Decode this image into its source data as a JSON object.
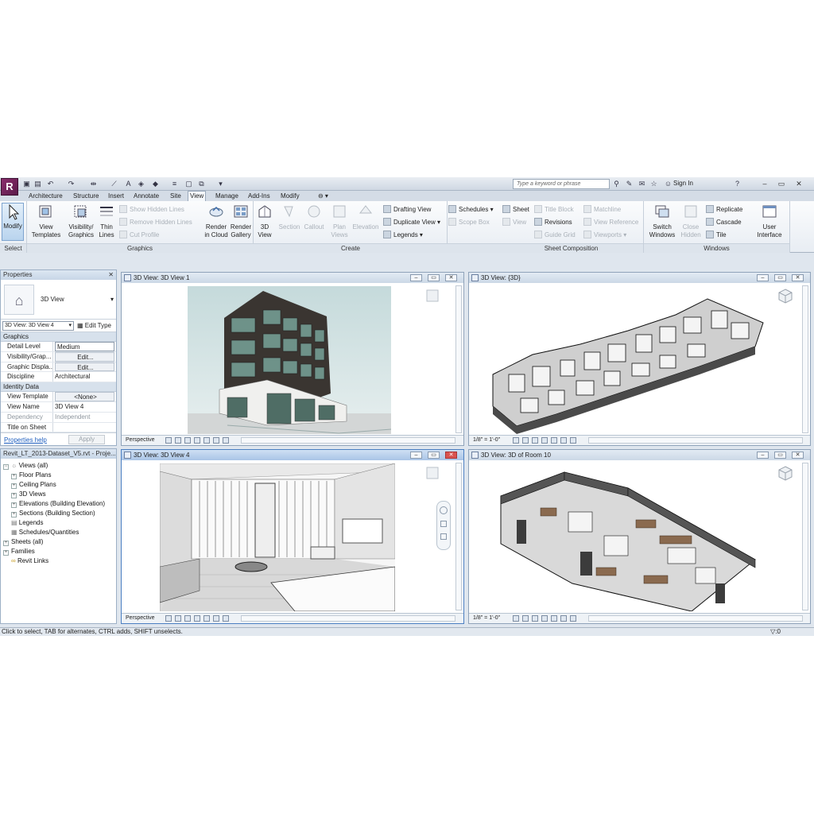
{
  "app": {
    "logo_letter": "R",
    "search_placeholder": "Type a keyword or phrase",
    "sign_in": "Sign In",
    "window_controls": [
      "–",
      "▭",
      "✕"
    ]
  },
  "tabs": [
    "Architecture",
    "Structure",
    "Insert",
    "Annotate",
    "Site",
    "View",
    "Manage",
    "Add-Ins",
    "Modify"
  ],
  "active_tab": "View",
  "ribbon": {
    "select": {
      "modify": "Modify",
      "title": "Select"
    },
    "graphics": {
      "title": "Graphics",
      "view_templates": [
        "View",
        "Templates"
      ],
      "visibility_graphics": [
        "Visibility/",
        "Graphics"
      ],
      "thin_lines": [
        "Thin",
        "Lines"
      ],
      "show_hidden_lines": "Show  Hidden Lines",
      "remove_hidden_lines": "Remove  Hidden Lines",
      "cut_profile": "Cut  Profile"
    },
    "create": {
      "title": "Create",
      "render_in_cloud": [
        "Render",
        "in Cloud"
      ],
      "render_gallery": [
        "Render",
        "Gallery"
      ],
      "view_3d": [
        "3D",
        "View"
      ],
      "section": "Section",
      "callout": "Callout",
      "plan_views": [
        "Plan",
        "Views"
      ],
      "elevation": "Elevation",
      "drafting_view": "Drafting  View",
      "duplicate_view": "Duplicate  View",
      "legends": "Legends",
      "schedules": "Schedules",
      "scope_box": "Scope  Box"
    },
    "sheet_composition": {
      "title": "Sheet Composition",
      "sheet": "Sheet",
      "view": "View",
      "title_block": "Title  Block",
      "revisions": "Revisions",
      "guide_grid": "Guide  Grid",
      "matchline": "Matchline",
      "view_reference": "View  Reference",
      "viewports": "Viewports"
    },
    "windows": {
      "title": "Windows",
      "switch_windows": [
        "Switch",
        "Windows"
      ],
      "close_hidden": [
        "Close",
        "Hidden"
      ],
      "replicate": "Replicate",
      "cascade": "Cascade",
      "tile": "Tile",
      "user_interface": [
        "User",
        "Interface"
      ]
    }
  },
  "properties": {
    "header": "Properties",
    "type_name": "3D View",
    "selector": "3D View: 3D View 4",
    "edit_type": "Edit Type",
    "groups": [
      {
        "name": "Graphics",
        "rows": [
          {
            "key": "Detail Level",
            "value": "Medium",
            "kind": "box"
          },
          {
            "key": "Visibility/Grap...",
            "value": "Edit...",
            "kind": "btn"
          },
          {
            "key": "Graphic Displa...",
            "value": "Edit...",
            "kind": "btn"
          },
          {
            "key": "Discipline",
            "value": "Architectural",
            "kind": "text"
          }
        ]
      },
      {
        "name": "Identity Data",
        "rows": [
          {
            "key": "View Template",
            "value": "<None>",
            "kind": "btn"
          },
          {
            "key": "View Name",
            "value": "3D View 4",
            "kind": "text"
          },
          {
            "key": "Dependency",
            "value": "Independent",
            "kind": "dis"
          },
          {
            "key": "Title on Sheet",
            "value": "",
            "kind": "text"
          }
        ]
      }
    ],
    "help": "Properties help",
    "apply": "Apply"
  },
  "browser": {
    "header": "Revit_LT_2013-Dataset_V5.rvt - Proje...",
    "nodes": [
      {
        "label": "Views (all)",
        "level": 0,
        "exp": "−"
      },
      {
        "label": "Floor Plans",
        "level": 1,
        "exp": "+"
      },
      {
        "label": "Ceiling Plans",
        "level": 1,
        "exp": "+"
      },
      {
        "label": "3D Views",
        "level": 1,
        "exp": "+"
      },
      {
        "label": "Elevations (Building Elevation)",
        "level": 1,
        "exp": "+"
      },
      {
        "label": "Sections (Building Section)",
        "level": 1,
        "exp": "+"
      },
      {
        "label": "Legends",
        "level": 0,
        "exp": ""
      },
      {
        "label": "Schedules/Quantities",
        "level": 0,
        "exp": ""
      },
      {
        "label": "Sheets (all)",
        "level": 0,
        "exp": "+"
      },
      {
        "label": "Families",
        "level": 0,
        "exp": "+"
      },
      {
        "label": "Revit Links",
        "level": 0,
        "exp": ""
      }
    ]
  },
  "viewports": [
    {
      "title": "3D View: 3D View 1",
      "scale": "Perspective"
    },
    {
      "title": "3D View: {3D}",
      "scale": "1/8\" = 1'-0\""
    },
    {
      "title": "3D View: 3D View 4",
      "scale": "Perspective"
    },
    {
      "title": "3D View: 3D of Room 10",
      "scale": "1/8\" = 1'-0\""
    }
  ],
  "status": {
    "text": "Click to select, TAB for alternates, CTRL adds, SHIFT unselects.",
    "filter": ":0"
  }
}
